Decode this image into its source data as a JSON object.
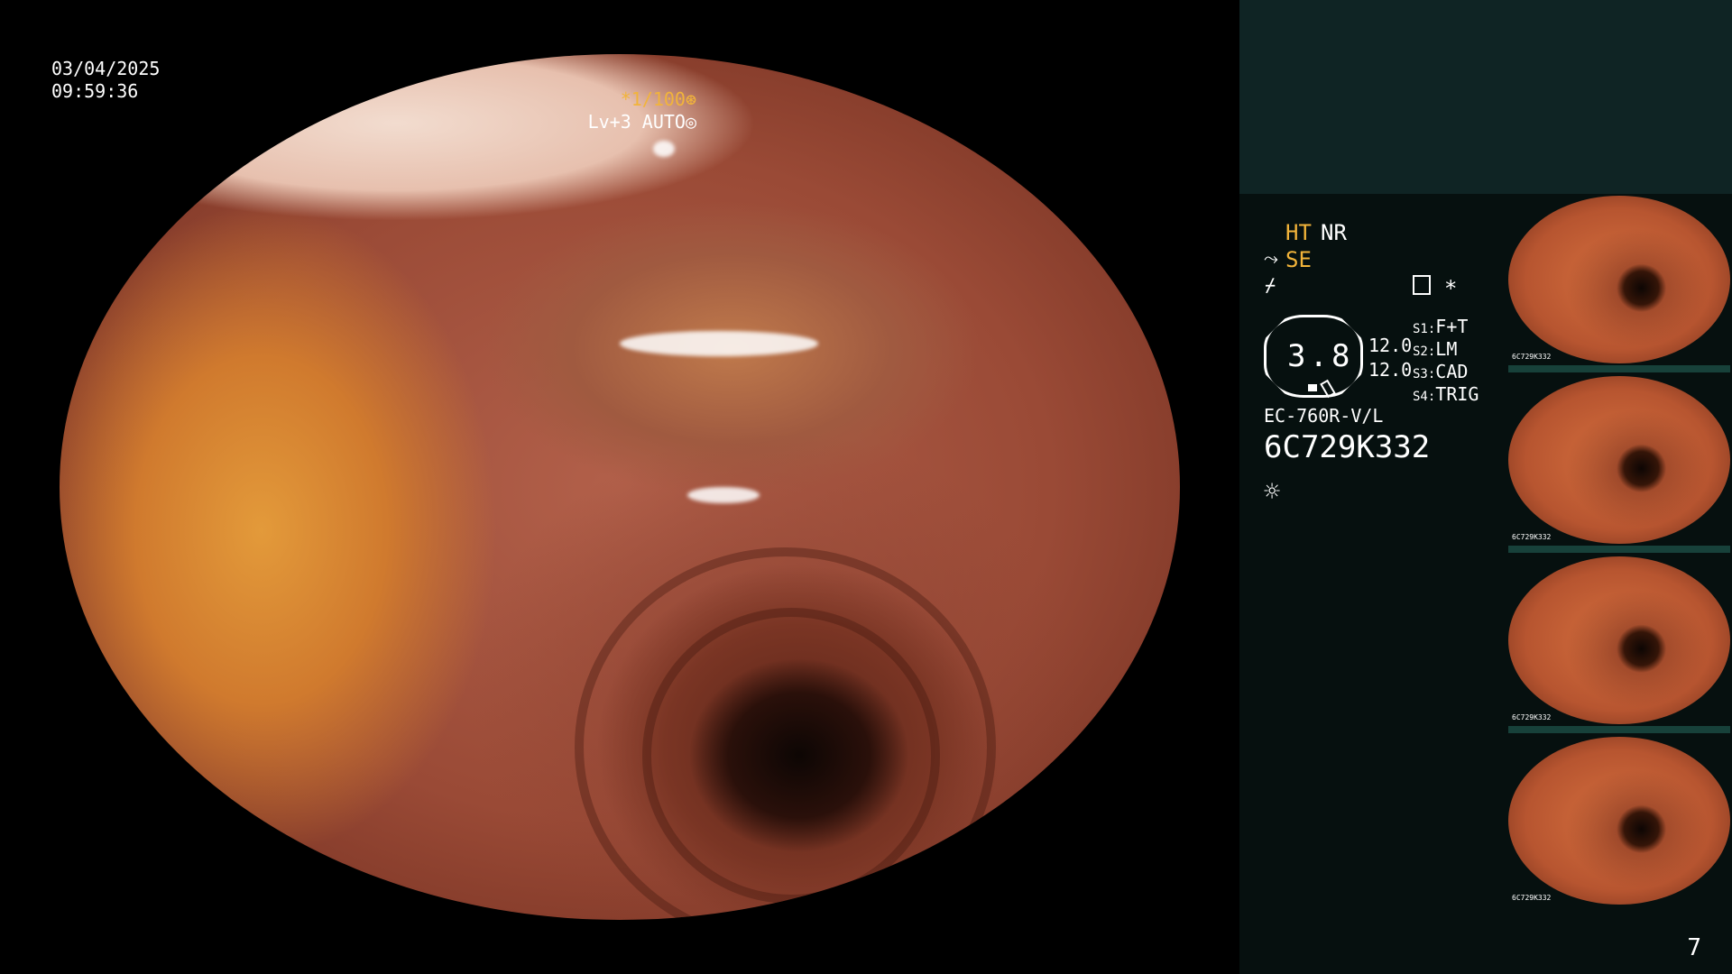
{
  "overlay": {
    "date": "03/04/2025",
    "time": "09:59:36",
    "shutter": "*1/100⊛",
    "level": "Lv+3 AUTO◎"
  },
  "panel": {
    "ht": "HT",
    "nr": "NR",
    "se_icon": "⤳",
    "se": "SE",
    "fn_icon": "⌿",
    "star": "*",
    "zoom_value": "3.8",
    "value_a": "12.0",
    "value_b": "12.0",
    "switches": [
      {
        "key": "S1:",
        "val": "F+T"
      },
      {
        "key": "S2:",
        "val": "LM"
      },
      {
        "key": "S3:",
        "val": "CAD"
      },
      {
        "key": "S4:",
        "val": "TRIG"
      }
    ],
    "model": "EC-760R-V/L",
    "serial": "6C729K332",
    "sun_icon": "☼"
  },
  "thumbnails": [
    {
      "label": "6C729K332"
    },
    {
      "label": "6C729K332"
    },
    {
      "label": "6C729K332"
    },
    {
      "label": "6C729K332"
    }
  ],
  "page_number": "7",
  "colors": {
    "accent_yellow": "#f2b43a",
    "panel_bg": "#06100f",
    "panel_top": "#0f2424"
  }
}
